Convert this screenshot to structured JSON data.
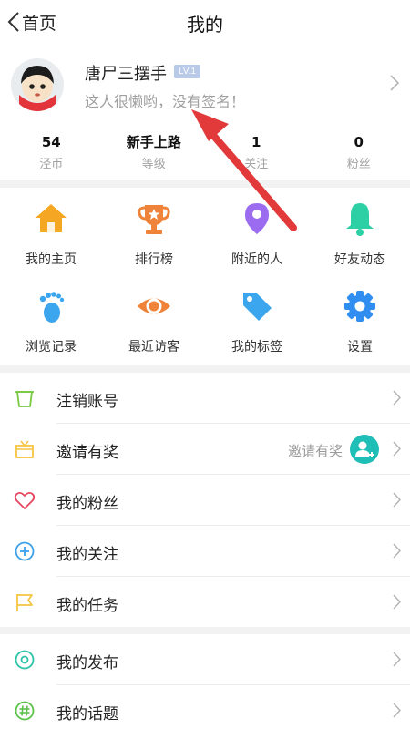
{
  "navbar": {
    "back_label": "首页",
    "title": "我的"
  },
  "profile": {
    "username": "唐尸三摆手",
    "level_badge": "LV.1",
    "signature": "这人很懒哟，没有签名！"
  },
  "stats": [
    {
      "value": "54",
      "label": "泾币"
    },
    {
      "value": "新手上路",
      "label": "等级"
    },
    {
      "value": "1",
      "label": "关注"
    },
    {
      "value": "0",
      "label": "粉丝"
    }
  ],
  "grid": [
    {
      "label": "我的主页",
      "icon": "home-icon",
      "color": "#f5a623"
    },
    {
      "label": "排行榜",
      "icon": "trophy-icon",
      "color": "#f0833a"
    },
    {
      "label": "附近的人",
      "icon": "location-pin-icon",
      "color": "#9b6cf0"
    },
    {
      "label": "好友动态",
      "icon": "bell-icon",
      "color": "#2dd0a5"
    },
    {
      "label": "浏览记录",
      "icon": "footprints-icon",
      "color": "#3ba6ee"
    },
    {
      "label": "最近访客",
      "icon": "eye-icon",
      "color": "#f0833a"
    },
    {
      "label": "我的标签",
      "icon": "tag-icon",
      "color": "#3ba6ee"
    },
    {
      "label": "设置",
      "icon": "gear-icon",
      "color": "#2f8ef0"
    }
  ],
  "list": [
    {
      "label": "注销账号",
      "icon": "trash-icon",
      "color": "#7ac943"
    },
    {
      "label": "邀请有奖",
      "icon": "gift-box-icon",
      "color": "#f5c542",
      "extra": "邀请有奖",
      "extra_icon": "add-user-icon"
    },
    {
      "label": "我的粉丝",
      "icon": "heart-icon",
      "color": "#e8455f"
    },
    {
      "label": "我的关注",
      "icon": "plus-circle-icon",
      "color": "#3aa0e8"
    },
    {
      "label": "我的任务",
      "icon": "flag-icon",
      "color": "#f5c542"
    },
    {
      "label": "我的发布",
      "icon": "target-icon",
      "color": "#2dc3a8"
    },
    {
      "label": "我的话题",
      "icon": "hashtag-icon",
      "color": "#5bc24a"
    }
  ],
  "colors": {
    "annotation_arrow": "#e23a3a",
    "chevron": "#b5b5b5"
  }
}
